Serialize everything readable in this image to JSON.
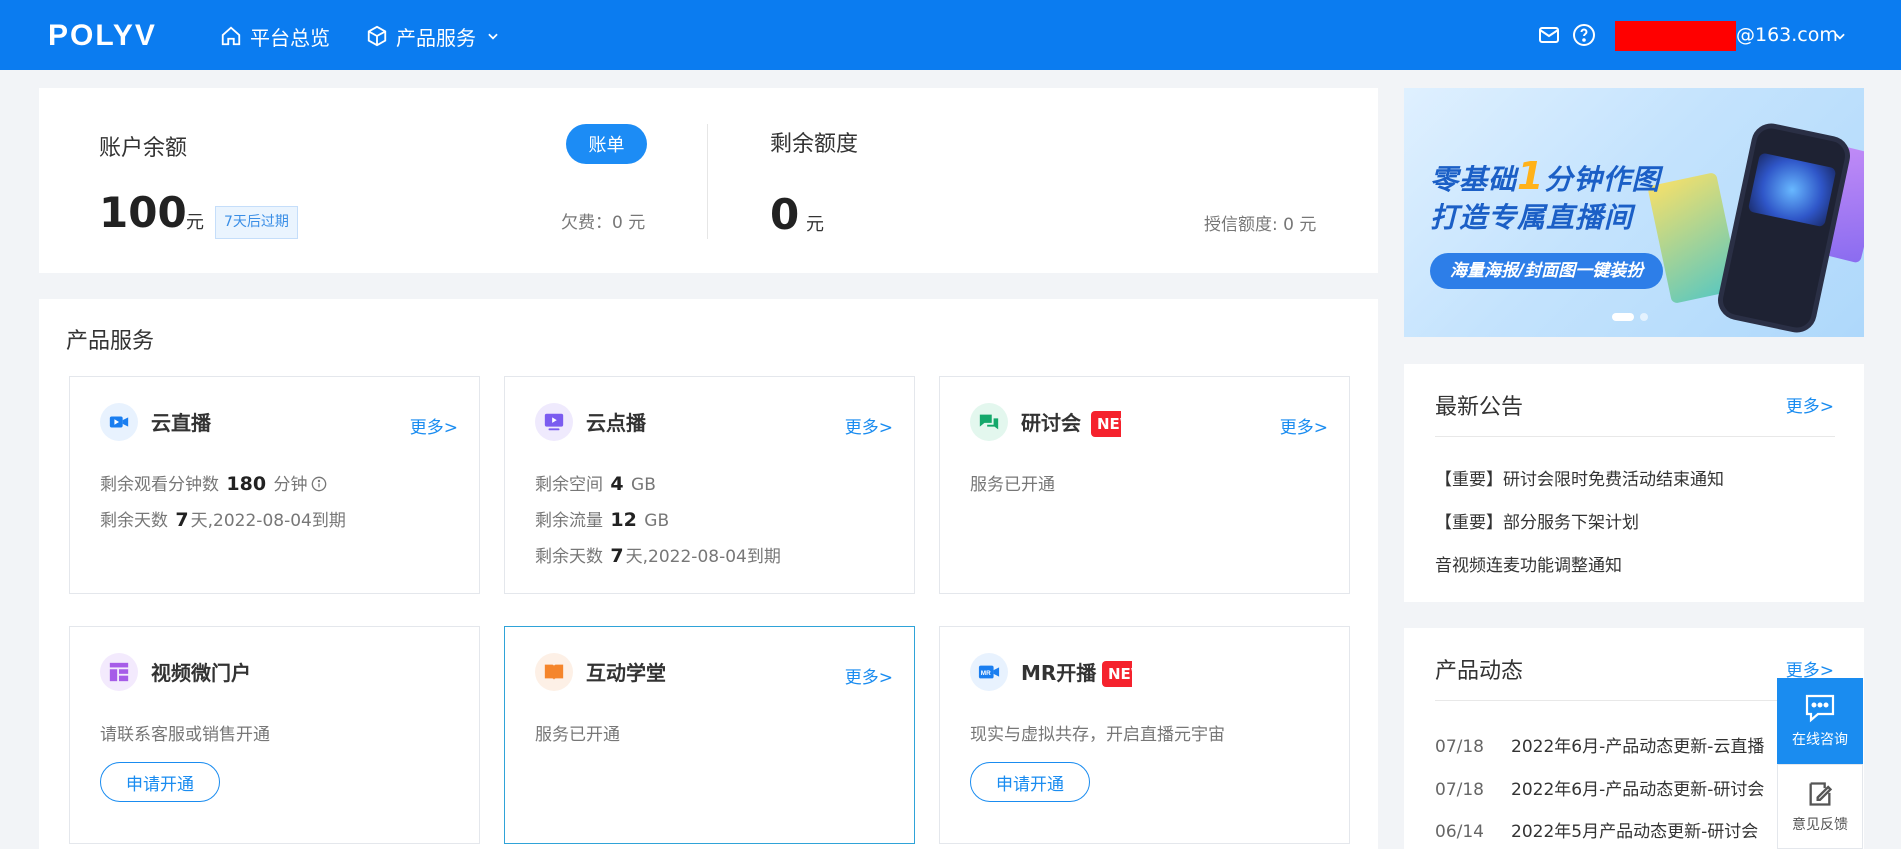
{
  "header": {
    "logo": "POLYV",
    "nav": [
      {
        "label": "平台总览",
        "icon": "home-icon"
      },
      {
        "label": "产品服务",
        "icon": "cube-icon"
      }
    ],
    "user_email": "@163.com",
    "icons": [
      "mail-icon",
      "help-icon",
      "chevron-down-icon"
    ]
  },
  "balance": {
    "title": "账户余额",
    "bill_button": "账单",
    "amount": "100",
    "unit": "元",
    "expire_badge": "7天后过期",
    "debt": "欠费：0 元"
  },
  "quota": {
    "title": "剩余额度",
    "amount": "0",
    "unit": "元",
    "credit": "授信额度: 0 元"
  },
  "banner": {
    "line1_a": "零基础",
    "line1_num": "1",
    "line1_b": "分钟作图",
    "line2": "打造专属直播间",
    "pill": "海量海报/封面图一键装扮"
  },
  "products": {
    "title": "产品服务",
    "more": "更多>",
    "new_badge": "NEW",
    "apply_label": "申请开通",
    "items": [
      {
        "name": "云直播",
        "icon": "live-video-icon",
        "lines": [
          {
            "pre": "剩余观看分钟数",
            "val": "180",
            "post": "分钟"
          },
          {
            "pre": "剩余天数",
            "val": "7",
            "post": "天,2022-08-04到期"
          }
        ]
      },
      {
        "name": "云点播",
        "icon": "vod-play-icon",
        "lines": [
          {
            "pre": "剩余空间",
            "val": "4",
            "post": "GB"
          },
          {
            "pre": "剩余流量",
            "val": "12",
            "post": "GB"
          },
          {
            "pre": "剩余天数",
            "val": "7",
            "post": "天,2022-08-04到期"
          }
        ]
      },
      {
        "name": "研讨会",
        "icon": "seminar-chat-icon",
        "status": "服务已开通"
      },
      {
        "name": "视频微门户",
        "icon": "portal-layout-icon",
        "status": "请联系客服或销售开通"
      },
      {
        "name": "互动学堂",
        "icon": "open-book-icon",
        "status": "服务已开通"
      },
      {
        "name": "MR开播",
        "icon": "mr-camera-icon",
        "status": "现实与虚拟共存，开启直播元宇宙"
      }
    ]
  },
  "notices": {
    "title": "最新公告",
    "more": "更多>",
    "items": [
      "【重要】研讨会限时免费活动结束通知",
      "【重要】部分服务下架计划",
      "音视频连麦功能调整通知"
    ]
  },
  "updates": {
    "title": "产品动态",
    "more": "更多>",
    "items": [
      {
        "date": "07/18",
        "text": "2022年6月-产品动态更新-云直播"
      },
      {
        "date": "07/18",
        "text": "2022年6月-产品动态更新-研讨会"
      },
      {
        "date": "06/14",
        "text": "2022年5月产品动态更新-研讨会"
      }
    ]
  },
  "float": {
    "consult": "在线咨询",
    "feedback": "意见反馈"
  },
  "colors": {
    "header_bg": "#0b7cf0",
    "accent": "#1a8cf0",
    "new_badge": "#f5222d"
  }
}
